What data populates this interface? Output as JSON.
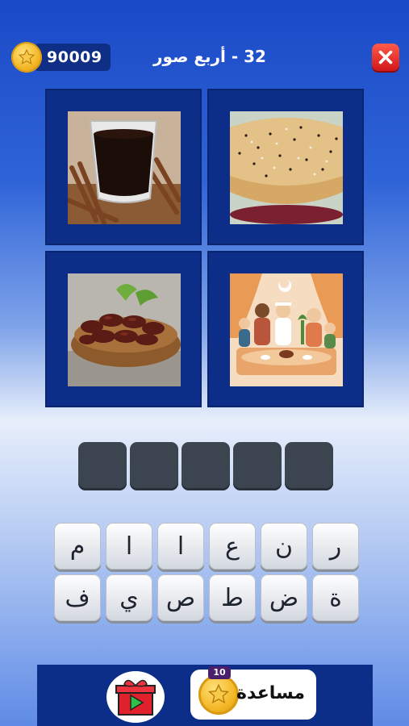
{
  "header": {
    "coins": "90009",
    "level_title": "32 - أربع صور"
  },
  "pictures": [
    {
      "name": "tea-cinnamon"
    },
    {
      "name": "sesame-pie"
    },
    {
      "name": "dates-bowl"
    },
    {
      "name": "family-iftar"
    }
  ],
  "answer_slots": 5,
  "keyboard": {
    "row1": [
      "ر",
      "ن",
      "ع",
      "ا",
      "ا",
      "م"
    ],
    "row2": [
      "ة",
      "ض",
      "ط",
      "ص",
      "ي",
      "ف"
    ]
  },
  "footer": {
    "help_label": "مساعدة",
    "help_cost": "10"
  }
}
